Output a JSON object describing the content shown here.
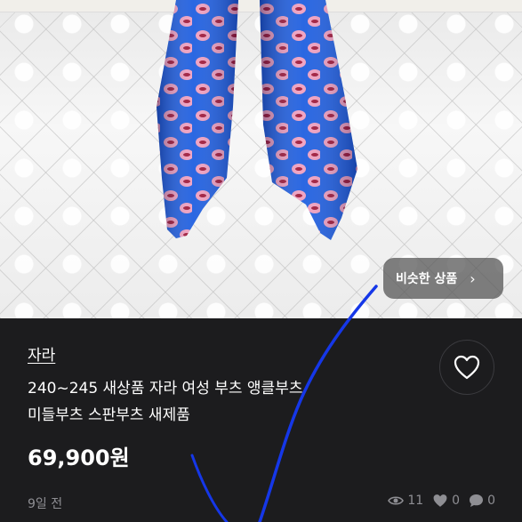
{
  "photo": {
    "similar_button": {
      "label": "비슷한 상품",
      "chevron": "›",
      "icon": "chevron-right-icon"
    }
  },
  "product": {
    "brand": "자라",
    "title_line1": "240~245 새상품 자라 여성 부츠 앵클부츠",
    "title_line2": "미들부츠 스판부츠 새제품",
    "price": "69,900원",
    "posted": "9일 전"
  },
  "stats": {
    "views": "11",
    "likes": "0",
    "chats": "0"
  },
  "colors": {
    "boot_blue": "#1f5fe0",
    "lip_pink": "#f0a0c0",
    "lip_red": "#a01838",
    "panel_bg": "#1c1c1e",
    "scribble": "#1537e8"
  }
}
